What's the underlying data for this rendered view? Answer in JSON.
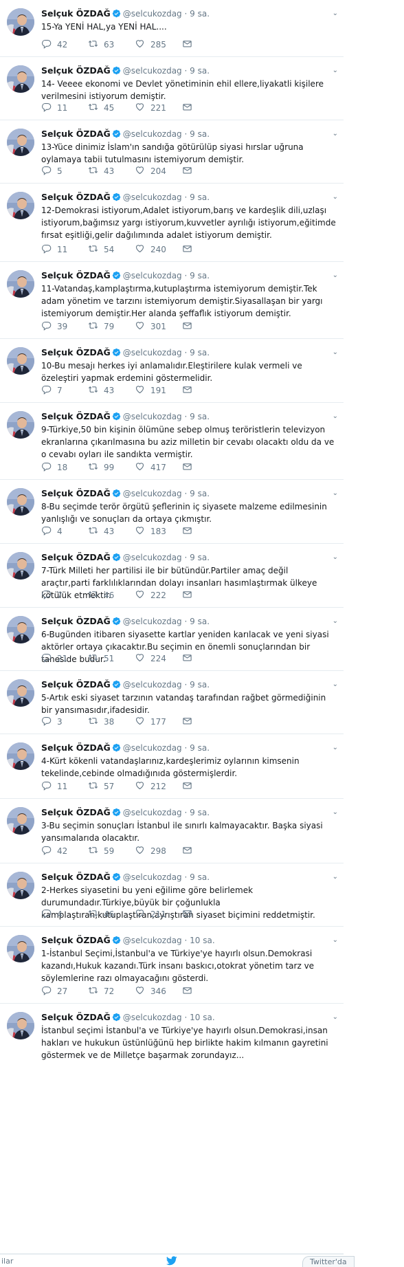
{
  "author": {
    "name": "Selçuk ÖZDAĞ",
    "handle": "@selcukozdag"
  },
  "tweets": [
    {
      "time": "9 sa.",
      "text": "15-Ya YENİ HAL,ya YENİ HAL....",
      "replies": "42",
      "retweets": "63",
      "likes": "285"
    },
    {
      "time": "9 sa.",
      "text": "14- Veeee ekonomi ve Devlet yönetiminin ehil ellere,liyakatli kişilere verilmesini istiyorum demiştir.",
      "replies": "11",
      "retweets": "45",
      "likes": "221"
    },
    {
      "time": "9 sa.",
      "text": "13-Yüce dinimiz İslam'ın sandığa götürülüp siyasi hırslar uğruna oylamaya tabii tutulmasını istemiyorum demiştir.",
      "replies": "5",
      "retweets": "43",
      "likes": "204"
    },
    {
      "time": "9 sa.",
      "text": "12-Demokrasi istiyorum,Adalet istiyorum,barış ve kardeşlik dili,uzlaşı istiyorum,bağımsız yargı istiyorum,kuvvetler ayrılığı istiyorum,eğitimde fırsat eşitliği,gelir dağılımında adalet istiyorum demiştir.",
      "replies": "11",
      "retweets": "54",
      "likes": "240"
    },
    {
      "time": "9 sa.",
      "text": "11-Vatandaş,kamplaştırma,kutuplaştırma istemiyorum demiştir.Tek adam yönetim ve tarzını istemiyorum demiştir.Siyasallaşan bir yargı istemiyorum demiştir.Her alanda şeffaflık istiyorum demiştir.",
      "replies": "39",
      "retweets": "79",
      "likes": "301"
    },
    {
      "time": "9 sa.",
      "text": "10-Bu mesajı herkes iyi anlamalıdır.Eleştirilere kulak vermeli ve özeleştiri yapmak erdemini göstermelidir.",
      "replies": "7",
      "retweets": "43",
      "likes": "191"
    },
    {
      "time": "9 sa.",
      "text": "9-Türkiye,50 bin kişinin ölümüne sebep olmuş teröristlerin televizyon ekranlarına çıkarılmasına bu aziz milletin bir cevabı olacaktı oldu da ve o cevabı oyları ile sandıkta vermiştir.",
      "replies": "18",
      "retweets": "99",
      "likes": "417"
    },
    {
      "time": "9 sa.",
      "text": "8-Bu seçimde terör örgütü şeflerinin iç siyasete malzeme edilmesinin yanlışlığı ve sonuçları da ortaya çıkmıştır.",
      "replies": "4",
      "retweets": "43",
      "likes": "183"
    },
    {
      "time": "9 sa.",
      "text": "7-Türk Milleti her partilisi ile bir bütündür.Partiler amaç değil araçtır,parti farklılıklarından dolayı insanları hasımlaştırmak ülkeye kötülük etmektir.",
      "replies": "7",
      "retweets": "46",
      "likes": "222"
    },
    {
      "time": "9 sa.",
      "text": "6-Bugünden itibaren siyasette kartlar yeniden karılacak ve yeni siyasi aktörler ortaya çıkacaktır.Bu seçimin en önemli sonuçlarından bir taneside budur.",
      "replies": "21",
      "retweets": "51",
      "likes": "224"
    },
    {
      "time": "9 sa.",
      "text": "5-Artık eski siyaset tarzının vatandaş tarafından rağbet görmediğinin bir yansımasıdır,ifadesidir.",
      "replies": "3",
      "retweets": "38",
      "likes": "177"
    },
    {
      "time": "9 sa.",
      "text": "4-Kürt kökenli vatandaşlarınız,kardeşlerimiz oylarının kimsenin tekelinde,cebinde olmadığınıda göstermişlerdir.",
      "replies": "11",
      "retweets": "57",
      "likes": "212"
    },
    {
      "time": "9 sa.",
      "text": "3-Bu seçimin sonuçları İstanbul ile sınırlı kalmayacaktır. Başka siyasi yansımalarıda olacaktır.",
      "replies": "42",
      "retweets": "59",
      "likes": "298"
    },
    {
      "time": "9 sa.",
      "text": "2-Herkes siyasetini bu yeni eğilime göre belirlemek durumundadır.Türkiye,büyük bir çoğunlukla kamplaştıran,kutuplaştıran,ayrıştıran siyaset biçimini reddetmiştir.",
      "replies": "4",
      "retweets": "46",
      "likes": "211"
    },
    {
      "time": "10 sa.",
      "text": "1-İstanbul Seçimi,İstanbul'a ve Türkiye'ye hayırlı olsun.Demokrasi kazandı,Hukuk kazandı.Türk insanı baskıcı,otokrat yönetim tarz ve söylemlerine razı olmayacağını gösterdi.",
      "replies": "27",
      "retweets": "72",
      "likes": "346"
    },
    {
      "time": "10 sa.",
      "text": "İstanbul seçimi İstanbul'a ve Türkiye'ye hayırlı olsun.Demokrasi,insan hakları ve hukukun üstünlüğünü hep birlikte hakim kılmanın gayretini göstermek ve de Milletçe başarmak zorundayız...",
      "replies": "",
      "retweets": "",
      "likes": ""
    }
  ],
  "bottom": {
    "left_text": "ilar",
    "right_text": "Twitter'da"
  },
  "colors": {
    "text": "#14171a",
    "muted": "#657786",
    "verified": "#1da1f2",
    "border": "#e6ecf0"
  }
}
